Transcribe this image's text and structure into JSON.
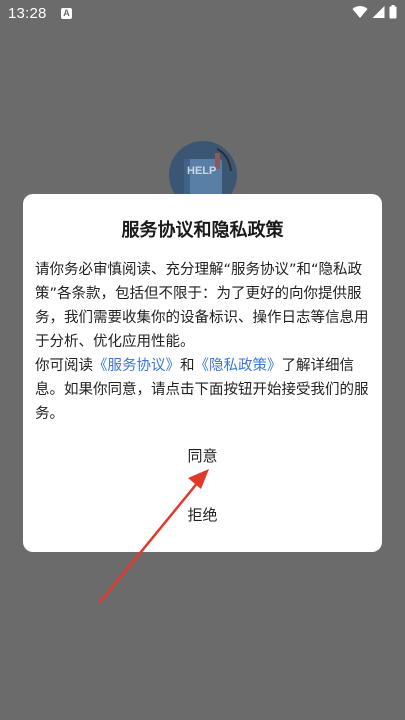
{
  "status_bar": {
    "time": "13:28",
    "notification_icon": "A",
    "icons": [
      "wifi-icon",
      "signal-icon",
      "battery-icon"
    ]
  },
  "background": {
    "app_icon_label": "HELP"
  },
  "dialog": {
    "title": "服务协议和隐私政策",
    "body_para1": "请你务必审慎阅读、充分理解“服务协议”和“隐私政策”各条款，包括但不限于：为了更好的向你提供服务，我们需要收集你的设备标识、操作日志等信息用于分析、优化应用性能。",
    "body_para2_prefix": "你可阅读",
    "service_agreement_link": "《服务协议》",
    "body_para2_and": "和",
    "privacy_policy_link": "《隐私政策》",
    "body_para2_suffix": "了解详细信息。如果你同意，请点击下面按钮开始接受我们的服务。",
    "agree_label": "同意",
    "reject_label": "拒绝"
  },
  "colors": {
    "overlay": "#6b6b6b",
    "dialog_bg": "#ffffff",
    "link": "#3a78d8",
    "annotation_arrow": "#e03a2a"
  }
}
